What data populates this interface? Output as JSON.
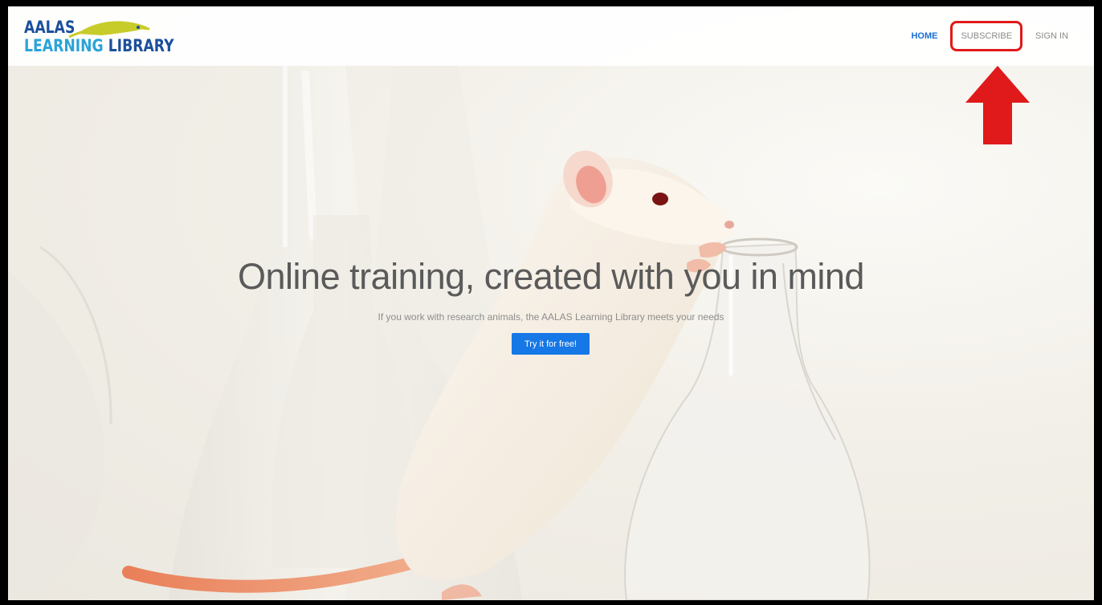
{
  "logo": {
    "line1": "AALAS",
    "line2_part_a": "LEARNING",
    "line2_part_b": "LIBRARY"
  },
  "nav": {
    "items": [
      {
        "label": "HOME",
        "active": true
      },
      {
        "label": "SUBSCRIBE",
        "highlighted": true
      },
      {
        "label": "SIGN IN"
      }
    ]
  },
  "hero": {
    "title": "Online training, created with you in mind",
    "subtitle": "If you work with research animals, the AALAS Learning Library meets your needs",
    "cta_label": "Try it for free!",
    "image": "white-rat-on-lab-flask"
  },
  "annotation": {
    "icon": "red-up-arrow-icon",
    "color": "#e01a1a",
    "target": "SUBSCRIBE"
  },
  "colors": {
    "accent": "#1678e6",
    "nav_active": "#1a6fd6",
    "logo_dark": "#1c4f9c",
    "logo_light": "#2aa3d8"
  }
}
